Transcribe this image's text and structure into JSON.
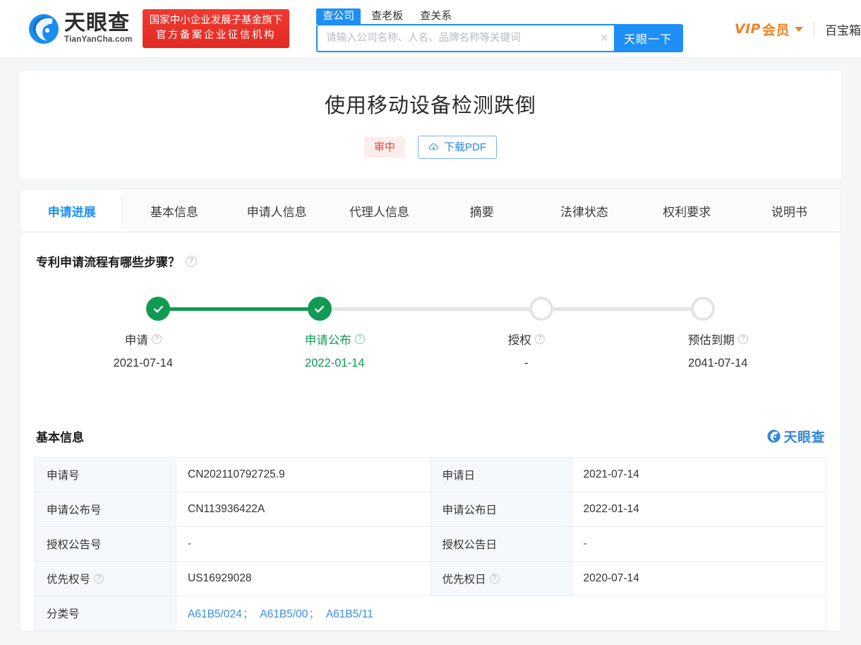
{
  "header": {
    "logo_cn": "天眼查",
    "logo_en": "TianYanCha.com",
    "gov_badge_line1": "国家中小企业发展子基金旗下",
    "gov_badge_line2": "官方备案企业征信机构",
    "search_tabs": [
      {
        "label": "查公司",
        "active": true
      },
      {
        "label": "查老板",
        "active": false
      },
      {
        "label": "查关系",
        "active": false
      }
    ],
    "search_placeholder": "请输入公司名称、人名、品牌名称等关键词",
    "search_value": "",
    "search_button": "天眼一下",
    "vip_label_en": "VIP",
    "vip_label_cn": "会员",
    "nav_link": "百宝箱",
    "accent_color": "#1e8ff5",
    "vip_color": "#f08326",
    "badge_red": "#e22a22"
  },
  "title_card": {
    "patent_title": "使用移动设备检测跌倒",
    "status_badge": "审中",
    "status_color": "#e8443c",
    "download_button": "下载PDF"
  },
  "tabs": [
    {
      "label": "申请进展",
      "active": true
    },
    {
      "label": "基本信息",
      "active": false
    },
    {
      "label": "申请人信息",
      "active": false
    },
    {
      "label": "代理人信息",
      "active": false
    },
    {
      "label": "摘要",
      "active": false
    },
    {
      "label": "法律状态",
      "active": false
    },
    {
      "label": "权利要求",
      "active": false
    },
    {
      "label": "说明书",
      "active": false
    }
  ],
  "progress": {
    "heading": "专利申请流程有哪些步骤？",
    "help_icon": "?",
    "done_color": "#109a54",
    "todo_color": "#e2e4e6",
    "steps": [
      {
        "name": "申请",
        "date": "2021-07-14",
        "state": "done",
        "current": false
      },
      {
        "name": "申请公布",
        "date": "2022-01-14",
        "state": "done",
        "current": true
      },
      {
        "name": "授权",
        "date": "-",
        "state": "todo",
        "current": false
      },
      {
        "name": "预估到期",
        "date": "2041-07-14",
        "state": "todo",
        "current": false
      }
    ]
  },
  "basic_info": {
    "heading": "基本信息",
    "watermark": "天眼查",
    "rows": [
      {
        "left_label": "申请号",
        "left_help": false,
        "left_value": "CN202110792725.9",
        "left_type": "text",
        "right_label": "申请日",
        "right_help": false,
        "right_value": "2021-07-14",
        "right_type": "text"
      },
      {
        "left_label": "申请公布号",
        "left_help": false,
        "left_value": "CN113936422A",
        "left_type": "text",
        "right_label": "申请公布日",
        "right_help": false,
        "right_value": "2022-01-14",
        "right_type": "text"
      },
      {
        "left_label": "授权公告号",
        "left_help": false,
        "left_value": "-",
        "left_type": "text",
        "right_label": "授权公告日",
        "right_help": false,
        "right_value": "-",
        "right_type": "text"
      },
      {
        "left_label": "优先权号",
        "left_help": true,
        "left_value": "US16929028",
        "left_type": "text",
        "right_label": "优先权日",
        "right_help": true,
        "right_value": "2020-07-14",
        "right_type": "text"
      }
    ],
    "classification": {
      "label": "分类号",
      "values": [
        "A61B5/024",
        "A61B5/00",
        "A61B5/11"
      ],
      "separator": "；",
      "link_color": "#3a8ee6"
    }
  }
}
